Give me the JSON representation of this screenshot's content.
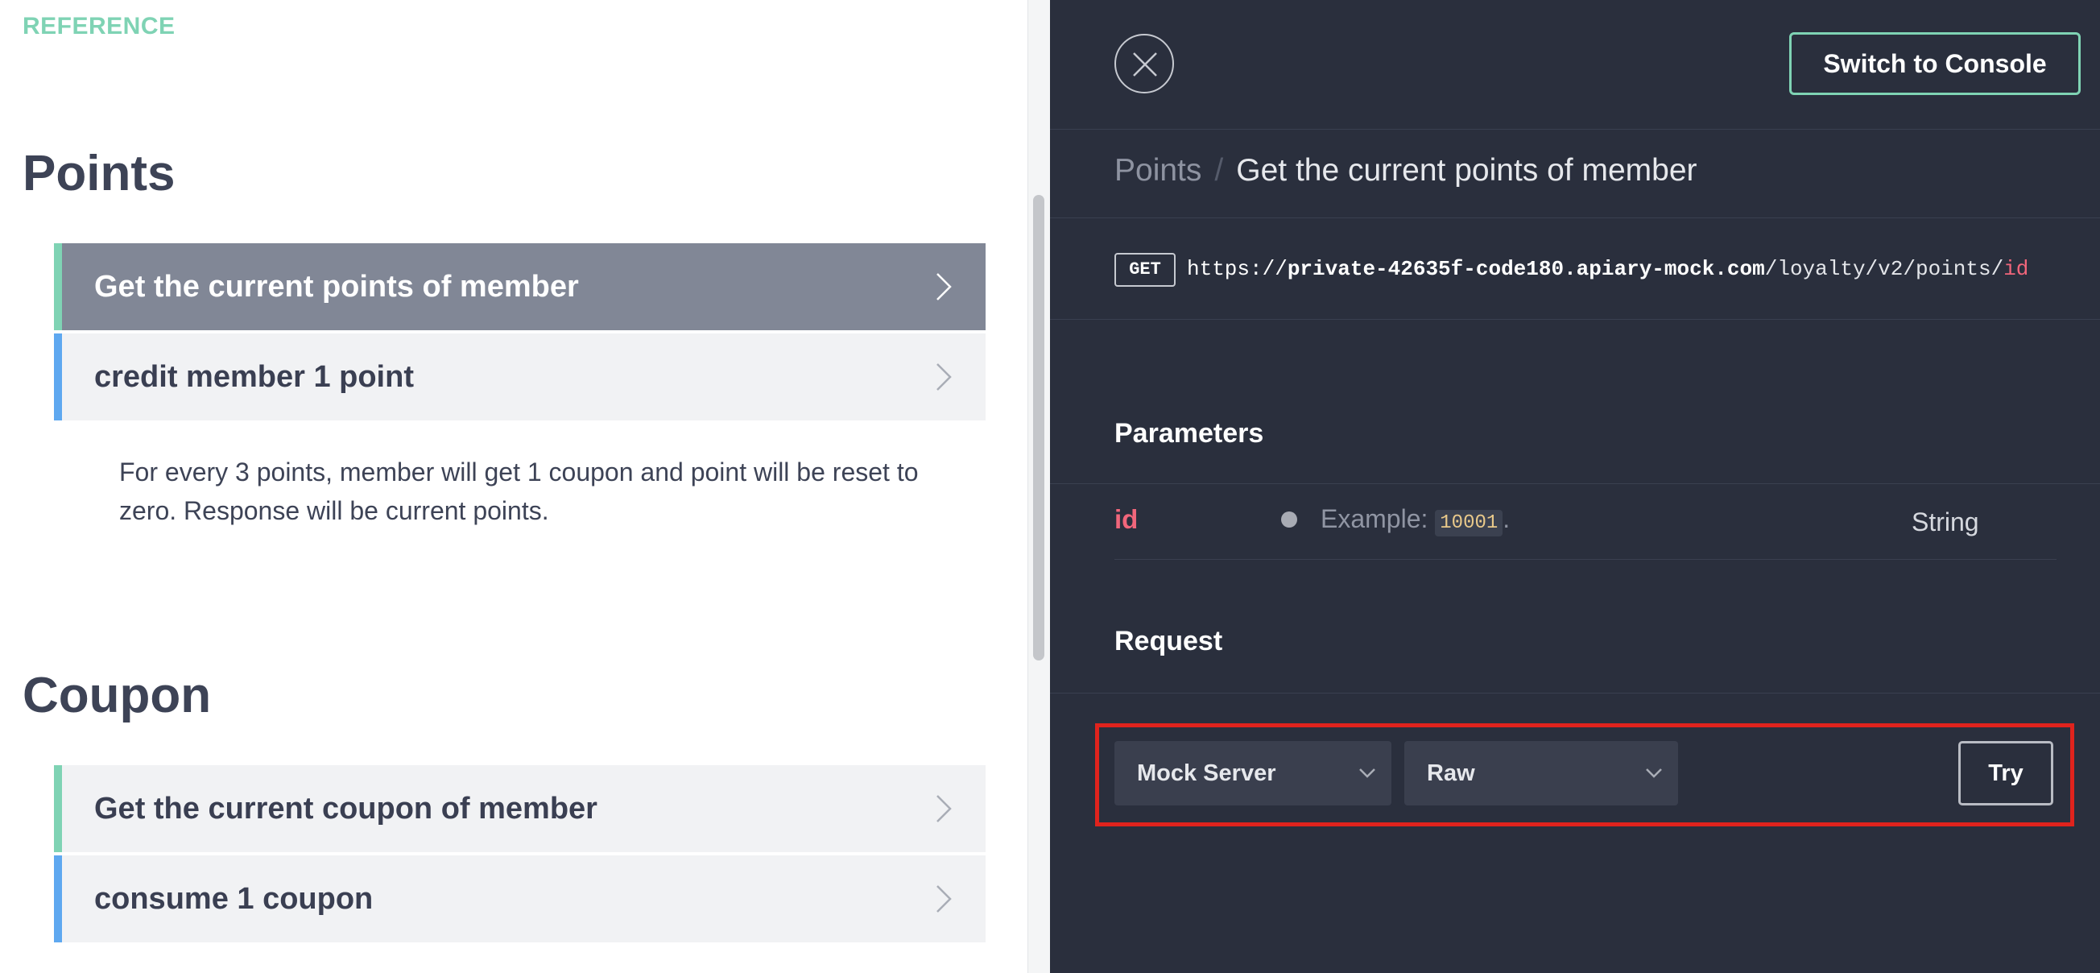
{
  "reference": {
    "label": "REFERENCE"
  },
  "sections": [
    {
      "title": "Points",
      "items": [
        {
          "label": "Get the current points of member",
          "active": true
        },
        {
          "label": "credit member 1 point",
          "active": false
        }
      ],
      "description": "For every 3 points, member will get 1 coupon and point will be reset to zero. Response will be current points."
    },
    {
      "title": "Coupon",
      "items": [
        {
          "label": "Get the current coupon of member",
          "active": false
        },
        {
          "label": "consume 1 coupon",
          "active": false
        }
      ]
    }
  ],
  "panel": {
    "switch_label": "Switch to Console",
    "breadcrumb": {
      "parent": "Points",
      "separator": "/",
      "current": "Get the current points of member"
    },
    "request_line": {
      "method": "GET",
      "scheme": "https://",
      "host": "private-42635f-code180.apiary-mock.com",
      "path": "/loyalty/v2/points/",
      "param": "id"
    },
    "parameters": {
      "heading": "Parameters",
      "rows": [
        {
          "name": "id",
          "example_prefix": "Example: ",
          "example_value": "10001",
          "example_suffix": ".",
          "type": "String"
        }
      ]
    },
    "request": {
      "heading": "Request",
      "server_select": "Mock Server",
      "format_select": "Raw",
      "try_label": "Try"
    }
  },
  "colors": {
    "accent_green": "#7fd3b4",
    "accent_blue": "#5ea8f0",
    "panel_bg": "#2a2f3d",
    "param_red": "#f1667b",
    "highlight_red": "#e0231d"
  },
  "icons": {
    "close": "close-icon",
    "chevron_right": "chevron-right-icon",
    "chevron_down": "chevron-down-icon"
  }
}
